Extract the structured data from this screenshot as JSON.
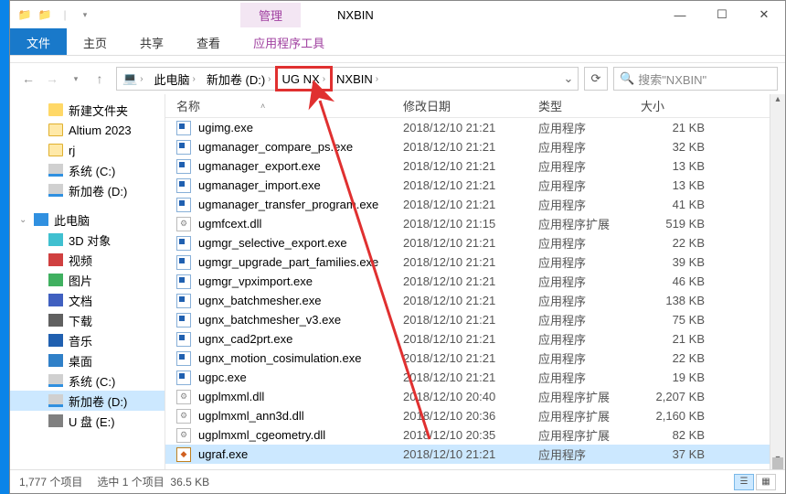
{
  "window": {
    "title": "NXBIN",
    "manage_tab": "管理",
    "tools_tab": "应用程序工具"
  },
  "ribbon": {
    "file": "文件",
    "home": "主页",
    "share": "共享",
    "view": "查看"
  },
  "breadcrumb": {
    "pc_icon": "💻",
    "segs": [
      "此电脑",
      "新加卷 (D:)",
      "UG NX",
      "NXBIN"
    ],
    "highlight_index": 2
  },
  "search": {
    "placeholder": "搜索\"NXBIN\""
  },
  "nav": {
    "quick": [
      {
        "label": "新建文件夹",
        "type": "folder"
      },
      {
        "label": "Altium 2023",
        "type": "folder o"
      },
      {
        "label": "rj",
        "type": "folder o"
      },
      {
        "label": "系统 (C:)",
        "type": "drive"
      },
      {
        "label": "新加卷 (D:)",
        "type": "drive"
      }
    ],
    "thispc_label": "此电脑",
    "thispc": [
      {
        "label": "3D 对象",
        "type": "obj3d"
      },
      {
        "label": "视频",
        "type": "video"
      },
      {
        "label": "图片",
        "type": "pic"
      },
      {
        "label": "文档",
        "type": "doc"
      },
      {
        "label": "下载",
        "type": "dl"
      },
      {
        "label": "音乐",
        "type": "music"
      },
      {
        "label": "桌面",
        "type": "desk"
      },
      {
        "label": "系统 (C:)",
        "type": "drive"
      },
      {
        "label": "新加卷 (D:)",
        "type": "drive",
        "sel": true
      },
      {
        "label": "U 盘 (E:)",
        "type": "usb"
      }
    ]
  },
  "columns": {
    "name": "名称",
    "date": "修改日期",
    "type": "类型",
    "size": "大小"
  },
  "files": [
    {
      "icon": "exe",
      "name": "ugimg.exe",
      "date": "2018/12/10 21:21",
      "type": "应用程序",
      "size": "21 KB"
    },
    {
      "icon": "exe",
      "name": "ugmanager_compare_ps.exe",
      "date": "2018/12/10 21:21",
      "type": "应用程序",
      "size": "32 KB"
    },
    {
      "icon": "exe",
      "name": "ugmanager_export.exe",
      "date": "2018/12/10 21:21",
      "type": "应用程序",
      "size": "13 KB"
    },
    {
      "icon": "exe",
      "name": "ugmanager_import.exe",
      "date": "2018/12/10 21:21",
      "type": "应用程序",
      "size": "13 KB"
    },
    {
      "icon": "exe",
      "name": "ugmanager_transfer_program.exe",
      "date": "2018/12/10 21:21",
      "type": "应用程序",
      "size": "41 KB"
    },
    {
      "icon": "dll",
      "name": "ugmfcext.dll",
      "date": "2018/12/10 21:15",
      "type": "应用程序扩展",
      "size": "519 KB"
    },
    {
      "icon": "exe",
      "name": "ugmgr_selective_export.exe",
      "date": "2018/12/10 21:21",
      "type": "应用程序",
      "size": "22 KB"
    },
    {
      "icon": "exe",
      "name": "ugmgr_upgrade_part_families.exe",
      "date": "2018/12/10 21:21",
      "type": "应用程序",
      "size": "39 KB"
    },
    {
      "icon": "exe",
      "name": "ugmgr_vpximport.exe",
      "date": "2018/12/10 21:21",
      "type": "应用程序",
      "size": "46 KB"
    },
    {
      "icon": "exe",
      "name": "ugnx_batchmesher.exe",
      "date": "2018/12/10 21:21",
      "type": "应用程序",
      "size": "138 KB"
    },
    {
      "icon": "exe",
      "name": "ugnx_batchmesher_v3.exe",
      "date": "2018/12/10 21:21",
      "type": "应用程序",
      "size": "75 KB"
    },
    {
      "icon": "exe",
      "name": "ugnx_cad2prt.exe",
      "date": "2018/12/10 21:21",
      "type": "应用程序",
      "size": "21 KB"
    },
    {
      "icon": "exe",
      "name": "ugnx_motion_cosimulation.exe",
      "date": "2018/12/10 21:21",
      "type": "应用程序",
      "size": "22 KB"
    },
    {
      "icon": "exe",
      "name": "ugpc.exe",
      "date": "2018/12/10 21:21",
      "type": "应用程序",
      "size": "19 KB"
    },
    {
      "icon": "dll",
      "name": "ugplmxml.dll",
      "date": "2018/12/10 20:40",
      "type": "应用程序扩展",
      "size": "2,207 KB"
    },
    {
      "icon": "dll",
      "name": "ugplmxml_ann3d.dll",
      "date": "2018/12/10 20:36",
      "type": "应用程序扩展",
      "size": "2,160 KB"
    },
    {
      "icon": "dll",
      "name": "ugplmxml_cgeometry.dll",
      "date": "2018/12/10 20:35",
      "type": "应用程序扩展",
      "size": "82 KB"
    },
    {
      "icon": "app",
      "name": "ugraf.exe",
      "date": "2018/12/10 21:21",
      "type": "应用程序",
      "size": "37 KB",
      "sel": true
    }
  ],
  "status": {
    "count": "1,777 个项目",
    "selection": "选中 1 个项目",
    "selsize": "36.5 KB"
  }
}
